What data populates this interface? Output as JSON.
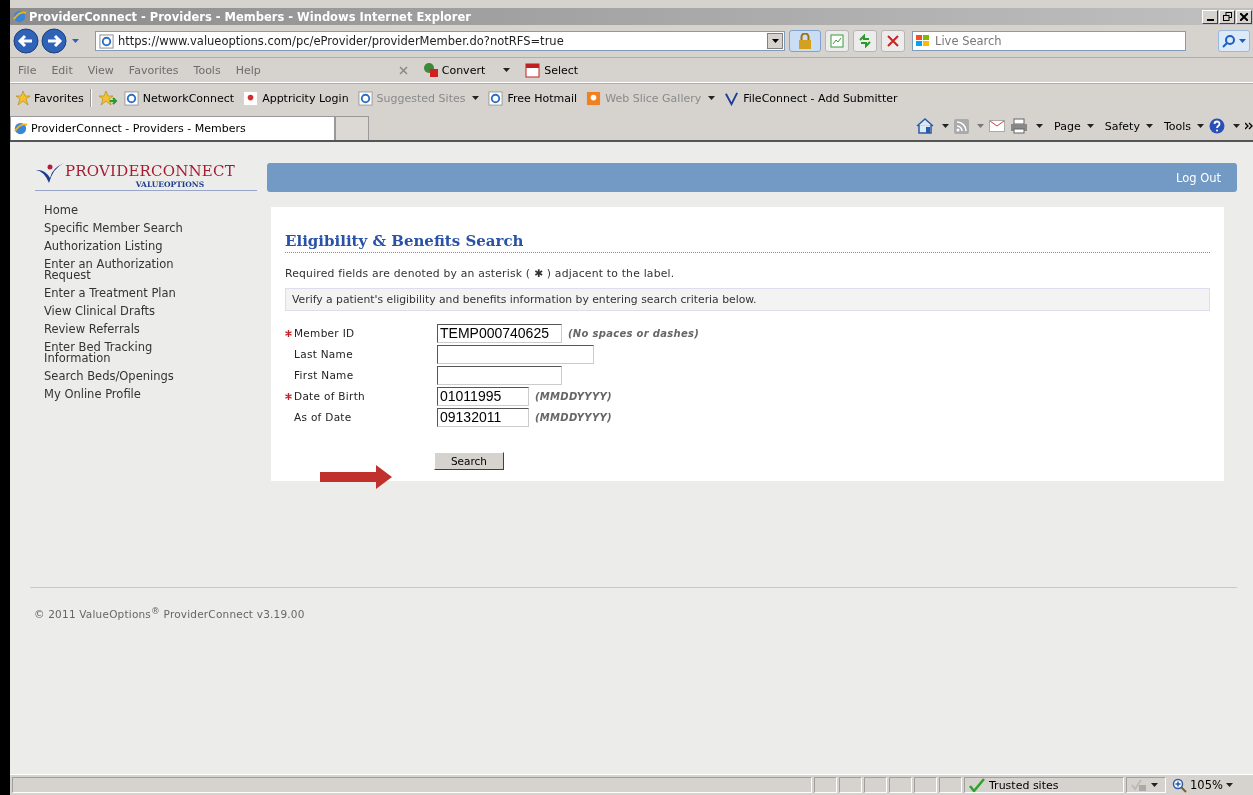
{
  "window": {
    "title": "ProviderConnect - Providers - Members - Windows Internet Explorer"
  },
  "address_bar": {
    "url": "https://www.valueoptions.com/pc/eProvider/providerMember.do?notRFS=true"
  },
  "search_box": {
    "placeholder": "Live Search"
  },
  "menu": [
    "File",
    "Edit",
    "View",
    "Favorites",
    "Tools",
    "Help"
  ],
  "addon_buttons": [
    "Convert",
    "Select"
  ],
  "favorites_bar": {
    "label": "Favorites",
    "links": [
      {
        "label": "NetworkConnect",
        "disabled": false,
        "dropdown": false
      },
      {
        "label": "Apptricity Login",
        "disabled": false,
        "dropdown": false
      },
      {
        "label": "Suggested Sites",
        "disabled": true,
        "dropdown": true
      },
      {
        "label": "Free Hotmail",
        "disabled": false,
        "dropdown": false
      },
      {
        "label": "Web Slice Gallery",
        "disabled": true,
        "dropdown": true
      },
      {
        "label": "FileConnect - Add Submitter",
        "disabled": false,
        "dropdown": false
      }
    ]
  },
  "tab": {
    "title": "ProviderConnect - Providers - Members"
  },
  "command_bar": [
    "Page",
    "Safety",
    "Tools"
  ],
  "logo": {
    "name": "PROVIDERCONNECT",
    "sub": "VALUEOPTIONS"
  },
  "header": {
    "logout": "Log Out"
  },
  "sidebar": {
    "items": [
      {
        "label": "Home"
      },
      {
        "label": "Specific Member Search"
      },
      {
        "label": "Authorization Listing"
      },
      {
        "label": "Enter an Authorization Request"
      },
      {
        "label": "Enter a Treatment Plan"
      },
      {
        "label": "View Clinical Drafts"
      },
      {
        "label": "Review Referrals"
      },
      {
        "label": "Enter Bed Tracking Information"
      },
      {
        "label": "Search Beds/Openings"
      },
      {
        "label": "My Online Profile"
      }
    ]
  },
  "form": {
    "title": "Eligibility & Benefits Search",
    "required_note": "Required fields are denoted by an asterisk ( ✱ ) adjacent to the label.",
    "instructions": "Verify a patient's eligibility and benefits information by entering search criteria below.",
    "fields": [
      {
        "label": "Member ID",
        "required": true,
        "value": "TEMP000740625",
        "hint": "(No spaces or dashes)"
      },
      {
        "label": "Last Name",
        "required": false
      },
      {
        "label": "First Name",
        "required": false
      },
      {
        "label": "Date of Birth",
        "required": true,
        "value": "01011995",
        "hint": "(MMDDYYYY)"
      },
      {
        "label": "As of Date",
        "required": false,
        "value": "09132011",
        "hint": "(MMDDYYYY)"
      }
    ],
    "submit": "Search"
  },
  "footer": {
    "copyright": "© 2011 ValueOptions$^{®}$ ProviderConnect v3.19.00"
  },
  "status_bar": {
    "zone": "Trusted sites",
    "zoom": "105%"
  }
}
